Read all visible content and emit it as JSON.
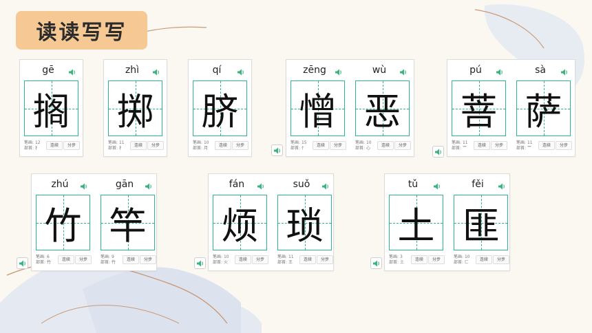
{
  "title": "读读写写",
  "labels": {
    "strokes": "笔画",
    "radical": "部首",
    "connect": "连续",
    "step": "分步"
  },
  "colors": {
    "grid": "#2cb58c",
    "speaker": "#3bb37e",
    "tag": "#f6c894"
  },
  "icons": {
    "speaker": "speaker-icon"
  },
  "cards": [
    {
      "chars": [
        {
          "pinyin": "gē",
          "hanzi": "搁",
          "strokes": "12",
          "radical": "扌"
        }
      ]
    },
    {
      "chars": [
        {
          "pinyin": "zhì",
          "hanzi": "掷",
          "strokes": "11",
          "radical": "扌"
        }
      ]
    },
    {
      "chars": [
        {
          "pinyin": "qí",
          "hanzi": "脐",
          "strokes": "10",
          "radical": "月"
        }
      ]
    },
    {
      "chars": [
        {
          "pinyin": "zēng",
          "hanzi": "憎",
          "strokes": "15",
          "radical": "忄"
        },
        {
          "pinyin": "wù",
          "hanzi": "恶",
          "strokes": "10",
          "radical": "心"
        }
      ]
    },
    {
      "chars": [
        {
          "pinyin": "pú",
          "hanzi": "菩",
          "strokes": "11",
          "radical": "艹"
        },
        {
          "pinyin": "sà",
          "hanzi": "萨",
          "strokes": "11",
          "radical": "艹"
        }
      ]
    },
    {
      "chars": [
        {
          "pinyin": "zhú",
          "hanzi": "竹",
          "strokes": "6",
          "radical": "竹"
        },
        {
          "pinyin": "gān",
          "hanzi": "竿",
          "strokes": "9",
          "radical": "竹"
        }
      ]
    },
    {
      "chars": [
        {
          "pinyin": "fán",
          "hanzi": "烦",
          "strokes": "10",
          "radical": "火"
        },
        {
          "pinyin": "suǒ",
          "hanzi": "琐",
          "strokes": "11",
          "radical": "王"
        }
      ]
    },
    {
      "chars": [
        {
          "pinyin": "tǔ",
          "hanzi": "土",
          "strokes": "3",
          "radical": "土"
        },
        {
          "pinyin": "fěi",
          "hanzi": "匪",
          "strokes": "10",
          "radical": "匚"
        }
      ]
    }
  ]
}
